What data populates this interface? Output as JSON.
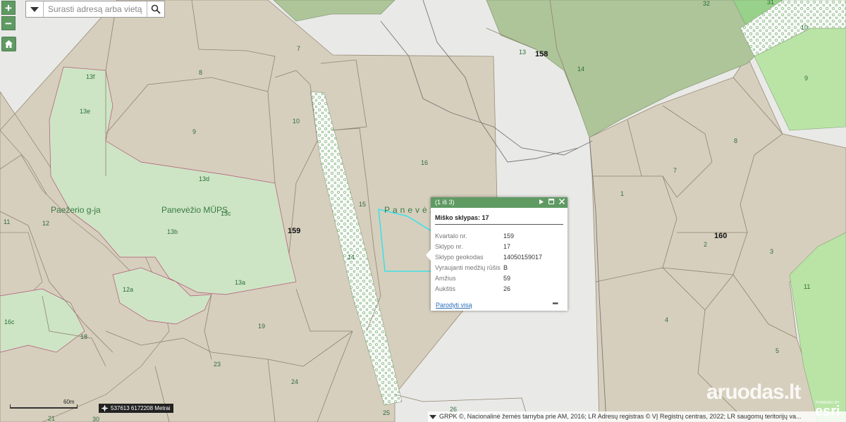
{
  "search": {
    "placeholder": "Surasti adresą arba vietą"
  },
  "zoom": {
    "in": "+",
    "out": "−"
  },
  "map": {
    "quarters": [
      "158",
      "159",
      "160"
    ],
    "plots": {
      "p32": "32",
      "p31": "31",
      "p10a": "10",
      "p7": "7",
      "p8": "8",
      "p13f": "13f",
      "p13e": "13e",
      "p9": "9",
      "p10": "10",
      "p16": "16",
      "p13d": "13d",
      "p15": "15",
      "p13c": "13c",
      "p13b": "13b",
      "p11": "11",
      "p12": "12",
      "p14": "14",
      "p13a": "13a",
      "p12a": "12a",
      "p16c": "16c",
      "p18": "18",
      "p19": "19",
      "p23": "23",
      "p24": "24",
      "p21": "21",
      "p30": "30",
      "p25": "25",
      "p26": "26",
      "p13": "13",
      "p14b": "14",
      "p9r": "9",
      "p8r": "8",
      "p7r": "7",
      "p1": "1",
      "p2": "2",
      "p3": "3",
      "p11r": "11",
      "p4": "4",
      "p5": "5"
    },
    "place_labels": {
      "street": "Paežerio g-ja",
      "school": "Panevėžio MŪPS",
      "town_partial": "Panevėž"
    }
  },
  "popup": {
    "counter": "(1 iš 3)",
    "title": "Miško sklypas: 17",
    "rows": [
      {
        "key": "Kvartalo nr.",
        "value": "159"
      },
      {
        "key": "Sklypo nr.",
        "value": "17"
      },
      {
        "key": "Sklypo geokodas",
        "value": "14050159017"
      },
      {
        "key": "Vyraujanti medžių rūšis",
        "value": "B"
      },
      {
        "key": "Amžius",
        "value": "59"
      },
      {
        "key": "Aukštis",
        "value": "26"
      }
    ],
    "show_all": "Parodyti visą",
    "more": "•••"
  },
  "scale": {
    "label": "60m"
  },
  "coords": {
    "text": "537613 6172208 Metrai"
  },
  "attribution": "GRPK ©, Nacionalinė žemės tarnyba prie AM, 2016; LR Adresų registras © VĮ Registrų centras, 2022; LR saugomų teritorijų va...",
  "watermark": "aruodas.lt",
  "esri": {
    "powered": "POWERED BY",
    "logo": "esri"
  },
  "colors": {
    "forest": "#d6cfbd",
    "green_zone": "#cde5c4",
    "dark_forest": "#aec59a",
    "bright_green": "#b9e4a6",
    "accent": "#5f9a63",
    "selection": "#40e0e8"
  }
}
